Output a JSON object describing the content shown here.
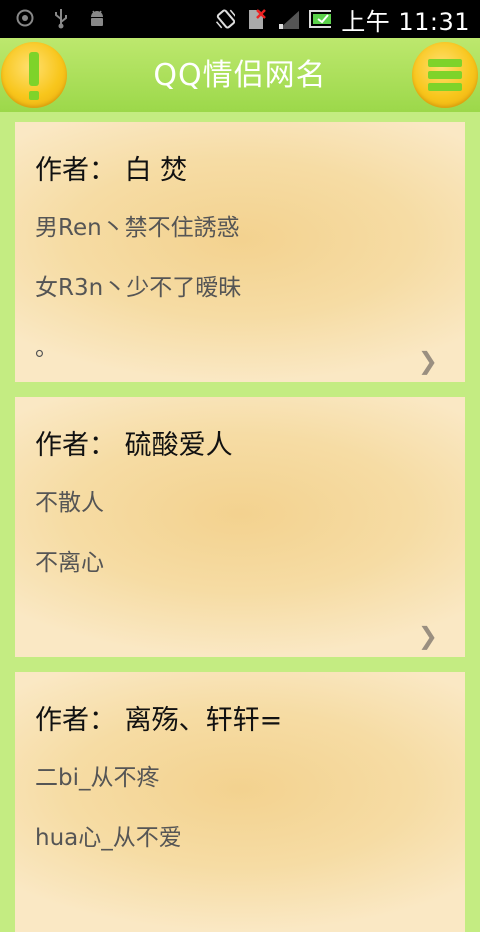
{
  "statusbar": {
    "time": "上午 11:31",
    "left_icons": [
      "record-icon",
      "usb-icon",
      "android-debug-icon"
    ],
    "right_icons": [
      "vibrate-icon",
      "no-sim-icon",
      "signal-icon",
      "battery-icon"
    ]
  },
  "header": {
    "title": "QQ情侣网名",
    "left_icon": "exclamation-icon",
    "right_icon": "menu-icon",
    "accent": "#7ed32a",
    "button_color": "#f8c61c"
  },
  "cards": [
    {
      "author": "作者： 白 焚",
      "lines": [
        "男Ren丶禁不住誘惑",
        "女R3n丶少不了暧昧",
        "。"
      ]
    },
    {
      "author": "作者： 硫酸爱人",
      "lines": [
        "不散人",
        "不离心",
        ""
      ]
    },
    {
      "author": "作者： 离殇、轩轩=",
      "lines": [
        "二bi_从不疼",
        "hua心_从不爱",
        ""
      ]
    }
  ]
}
